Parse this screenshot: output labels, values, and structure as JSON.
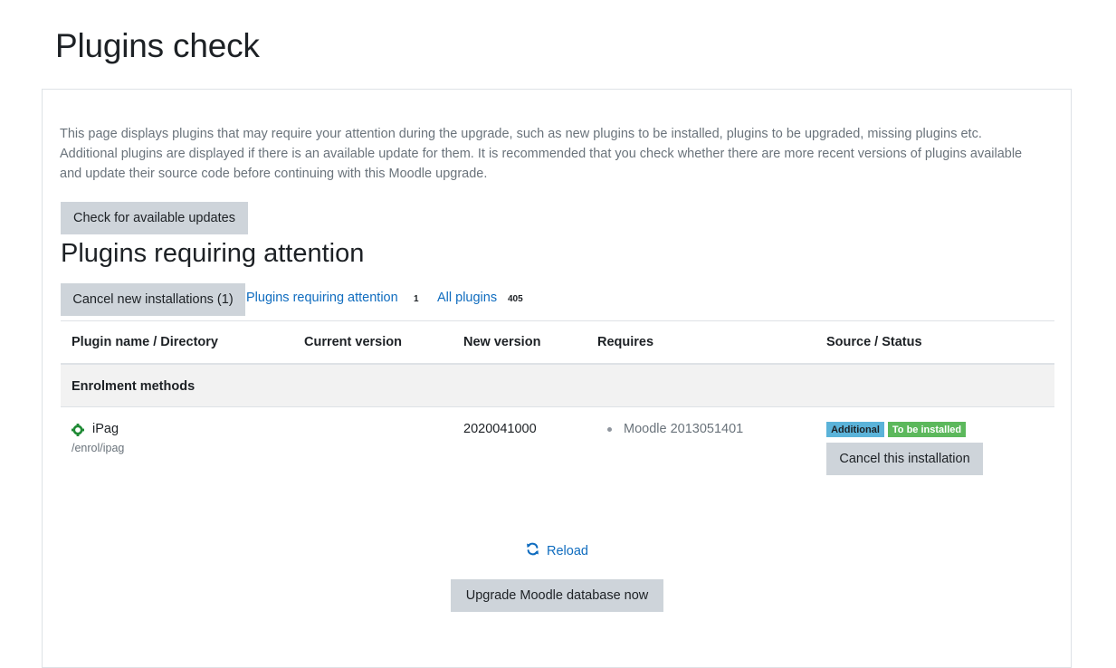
{
  "page": {
    "title": "Plugins check"
  },
  "intro": "This page displays plugins that may require your attention during the upgrade, such as new plugins to be installed, plugins to be upgraded, missing plugins etc. Additional plugins are displayed if there is an available update for them. It is recommended that you check whether there are more recent versions of plugins available and update their source code before continuing with this Moodle upgrade.",
  "buttons": {
    "check_updates": "Check for available updates",
    "cancel_new": "Cancel new installations (1)",
    "cancel_install": "Cancel this installation",
    "upgrade": "Upgrade Moodle database now"
  },
  "section": {
    "title": "Plugins requiring attention"
  },
  "filters": [
    {
      "label": "Plugins requiring attention",
      "count": "1"
    },
    {
      "label": "All plugins",
      "count": "405"
    }
  ],
  "table": {
    "headers": [
      "Plugin name / Directory",
      "Current version",
      "New version",
      "Requires",
      "Source / Status"
    ],
    "groups": [
      {
        "label": "Enrolment methods",
        "rows": [
          {
            "name": "iPag",
            "directory": "/enrol/ipag",
            "current_version": "",
            "new_version": "2020041000",
            "requires": [
              "Moodle 2013051401"
            ],
            "badges": [
              "Additional",
              "To be installed"
            ],
            "icon": "plugin-icon"
          }
        ]
      }
    ]
  },
  "reload": {
    "label": "Reload",
    "icon": "refresh-icon"
  },
  "colors": {
    "link": "#0f6cbf",
    "button_bg": "#ced4da",
    "badge_additional": "#5bb3d9",
    "badge_install": "#5cb85c",
    "muted_text": "#6a737b",
    "plugin_icon": "#1f8a35"
  }
}
